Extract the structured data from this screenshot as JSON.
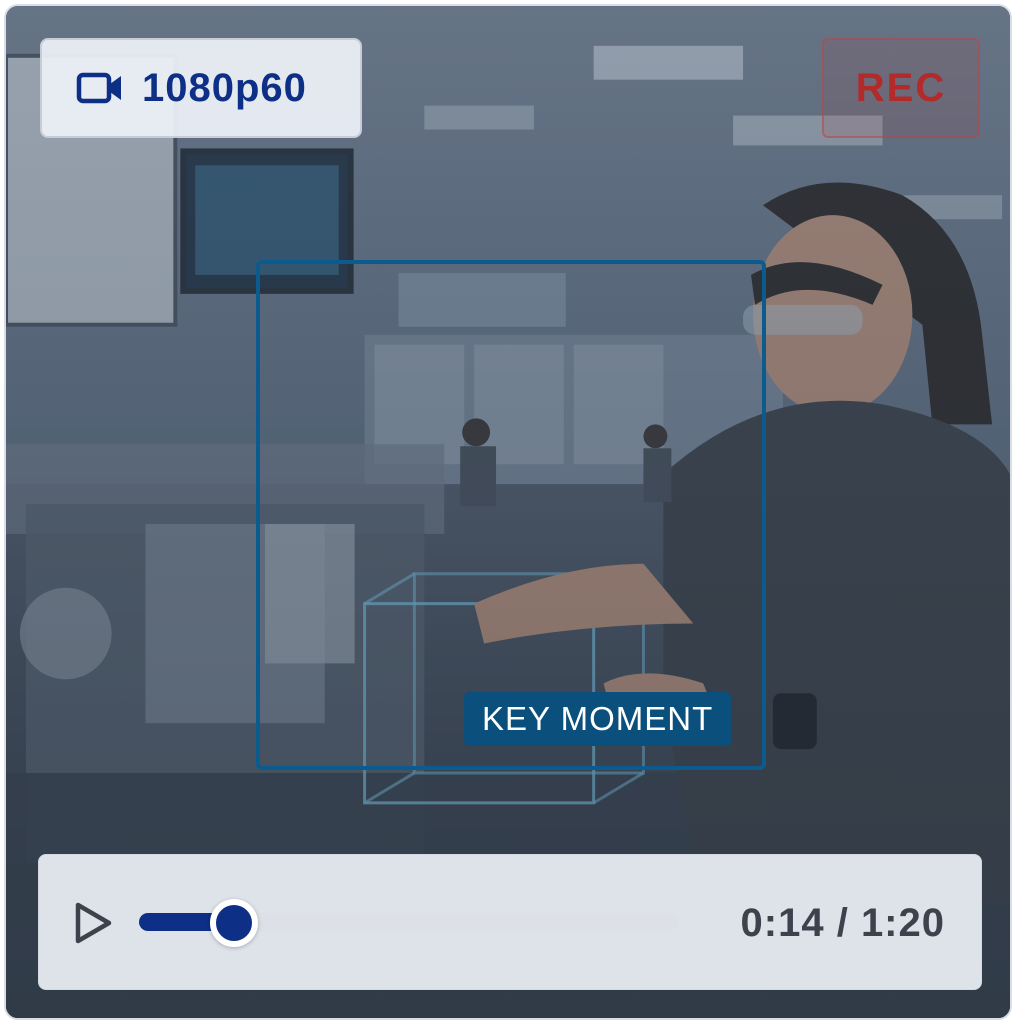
{
  "overlay": {
    "quality": {
      "icon": "video-camera-icon",
      "label": "1080p60"
    },
    "recording": {
      "label": "REC",
      "color": "#b22a2a"
    },
    "key_moment": {
      "label": "KEY MOMENT",
      "accent": "#0b5b8f"
    }
  },
  "player": {
    "play_icon": "play-icon",
    "progress": 0.175,
    "time": {
      "current": "0:14",
      "separator": " / ",
      "total": "1:20"
    },
    "accent": "#0d2f86"
  }
}
